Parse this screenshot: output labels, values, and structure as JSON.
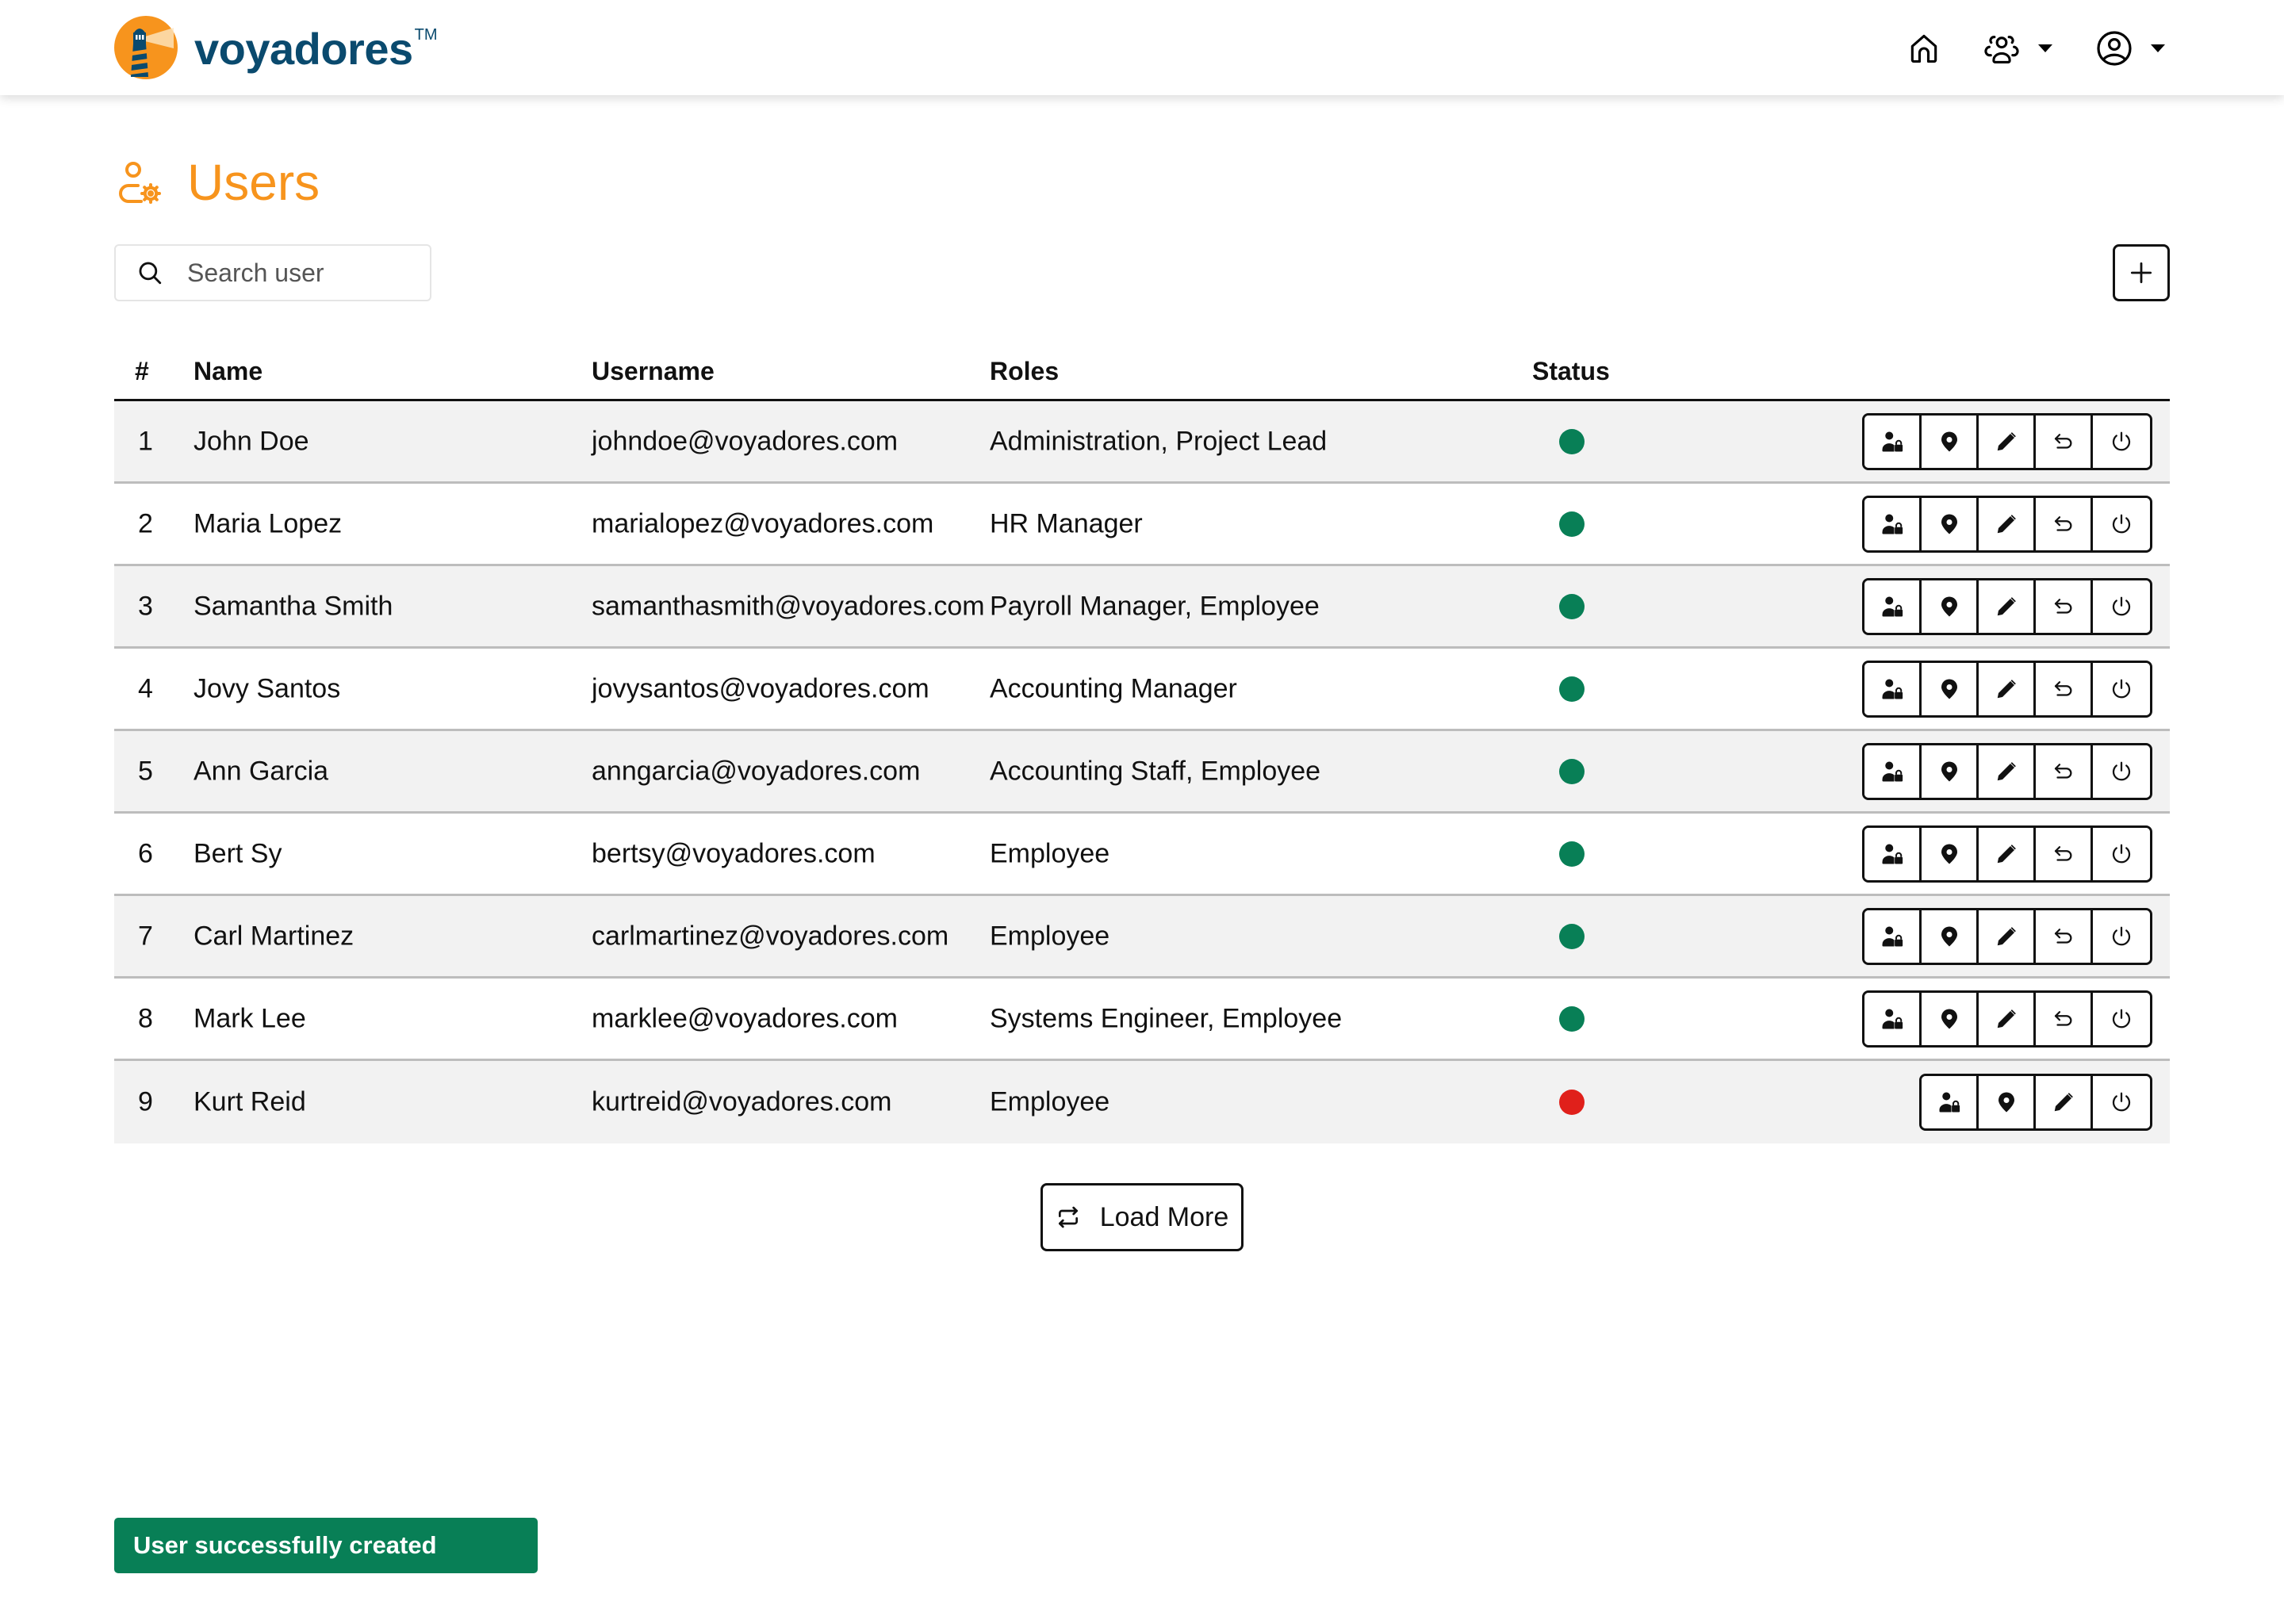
{
  "header": {
    "brand_name": "voyadores",
    "brand_tm": "TM",
    "nav": [
      {
        "icon": "home-icon",
        "label": "Home"
      },
      {
        "icon": "team-icon",
        "label": "Team",
        "has_dropdown": true
      },
      {
        "icon": "user-circle-icon",
        "label": "Account",
        "has_dropdown": true
      }
    ]
  },
  "page": {
    "title": "Users",
    "title_icon": "user-gear-icon",
    "accent_color": "#f7941d"
  },
  "search": {
    "placeholder": "Search user",
    "value": ""
  },
  "add_button": {
    "icon": "plus-icon",
    "label": "Add user"
  },
  "table": {
    "columns": [
      "#",
      "Name",
      "Username",
      "Roles",
      "Status"
    ],
    "rows": [
      {
        "num": "1",
        "name": "John Doe",
        "username": "johndoe@voyadores.com",
        "roles": "Administration, Project Lead",
        "status": "active"
      },
      {
        "num": "2",
        "name": "Maria Lopez",
        "username": "marialopez@voyadores.com",
        "roles": "HR Manager",
        "status": "active"
      },
      {
        "num": "3",
        "name": "Samantha Smith",
        "username": "samanthasmith@voyadores.com",
        "roles": "Payroll Manager, Employee",
        "status": "active"
      },
      {
        "num": "4",
        "name": "Jovy Santos",
        "username": "jovysantos@voyadores.com",
        "roles": "Accounting Manager",
        "status": "active"
      },
      {
        "num": "5",
        "name": "Ann Garcia",
        "username": "anngarcia@voyadores.com",
        "roles": "Accounting Staff, Employee",
        "status": "active"
      },
      {
        "num": "6",
        "name": "Bert Sy",
        "username": "bertsy@voyadores.com",
        "roles": "Employee",
        "status": "active"
      },
      {
        "num": "7",
        "name": "Carl Martinez",
        "username": "carlmartinez@voyadores.com",
        "roles": "Employee",
        "status": "active"
      },
      {
        "num": "8",
        "name": "Mark Lee",
        "username": "marklee@voyadores.com",
        "roles": "Systems Engineer, Employee",
        "status": "active"
      },
      {
        "num": "9",
        "name": "Kurt Reid",
        "username": "kurtreid@voyadores.com",
        "roles": "Employee",
        "status": "inactive"
      }
    ],
    "row_actions_active": [
      "user-lock-icon",
      "location-pin-icon",
      "pencil-icon",
      "undo-icon",
      "power-icon"
    ],
    "row_actions_inactive": [
      "user-lock-icon",
      "location-pin-icon",
      "pencil-icon",
      "power-icon"
    ],
    "status_colors": {
      "active": "#087f56",
      "inactive": "#e0201b"
    }
  },
  "load_more": {
    "label": "Load More",
    "icon": "repeat-icon"
  },
  "toast": {
    "message": "User successfully created",
    "color": "#087f56"
  }
}
